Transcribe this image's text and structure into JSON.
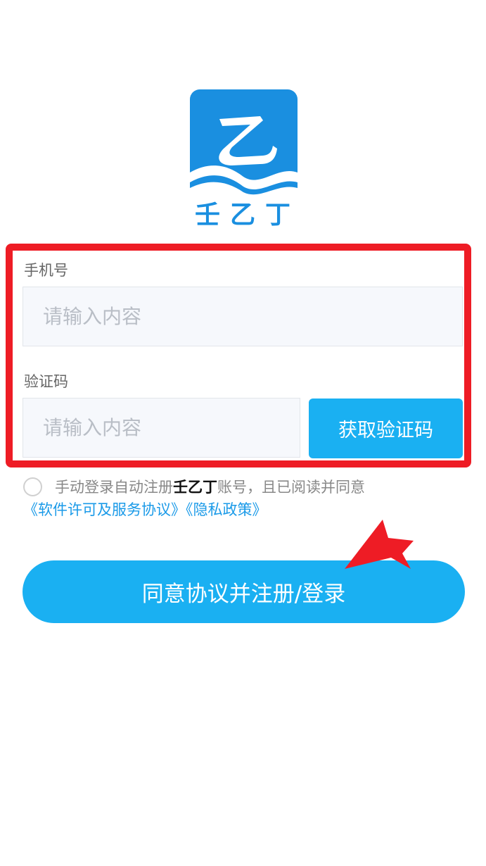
{
  "app": {
    "name": "壬乙丁",
    "logo_glyph": "乙",
    "logo_color": "#1a8fe0"
  },
  "form": {
    "phone_label": "手机号",
    "phone_placeholder": "请输入内容",
    "code_label": "验证码",
    "code_placeholder": "请输入内容",
    "get_code_button": "获取验证码"
  },
  "agreement": {
    "text_before": "手动登录自动注册",
    "brand": "壬乙丁",
    "text_after": "账号，且已阅读并同意",
    "license_link": "《软件许可及服务协议》",
    "privacy_link": "《隐私政策》",
    "checked": false
  },
  "submit": {
    "label": "同意协议并注册/登录"
  },
  "colors": {
    "accent": "#1ab0f2",
    "highlight": "#ee1c25",
    "link": "#1a9ae8"
  }
}
